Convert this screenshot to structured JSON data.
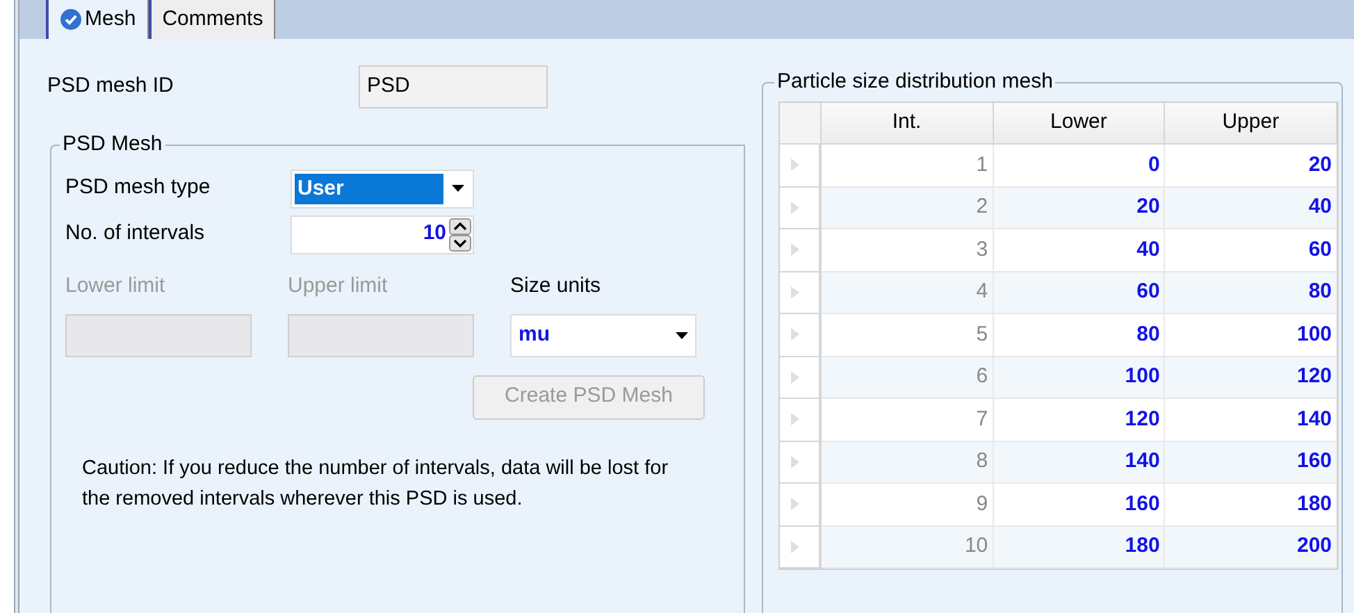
{
  "tabs": [
    {
      "label": "Mesh",
      "selected": true,
      "checked": true
    },
    {
      "label": "Comments",
      "selected": false,
      "checked": false
    }
  ],
  "mesh_id": {
    "label": "PSD mesh ID",
    "value": "PSD"
  },
  "psd_mesh": {
    "title": "PSD Mesh",
    "mesh_type": {
      "label": "PSD mesh type",
      "value": "User",
      "highlighted": true
    },
    "intervals": {
      "label": "No. of intervals",
      "value": "10"
    },
    "lower_limit": {
      "label": "Lower limit",
      "disabled": true
    },
    "upper_limit": {
      "label": "Upper limit",
      "disabled": true
    },
    "size_units": {
      "label": "Size units",
      "value": "mu"
    },
    "create_button": {
      "label": "Create PSD Mesh",
      "disabled": true
    },
    "caution": "Caution: If you reduce the number of intervals, data will be lost for the removed intervals wherever this PSD is used."
  },
  "distribution": {
    "title": "Particle size distribution mesh",
    "columns": [
      "Int.",
      "Lower",
      "Upper"
    ],
    "rows": [
      [
        "1",
        "0",
        "20"
      ],
      [
        "2",
        "20",
        "40"
      ],
      [
        "3",
        "40",
        "60"
      ],
      [
        "4",
        "60",
        "80"
      ],
      [
        "5",
        "80",
        "100"
      ],
      [
        "6",
        "100",
        "120"
      ],
      [
        "7",
        "120",
        "140"
      ],
      [
        "8",
        "140",
        "160"
      ],
      [
        "9",
        "160",
        "180"
      ],
      [
        "10",
        "180",
        "200"
      ]
    ]
  }
}
